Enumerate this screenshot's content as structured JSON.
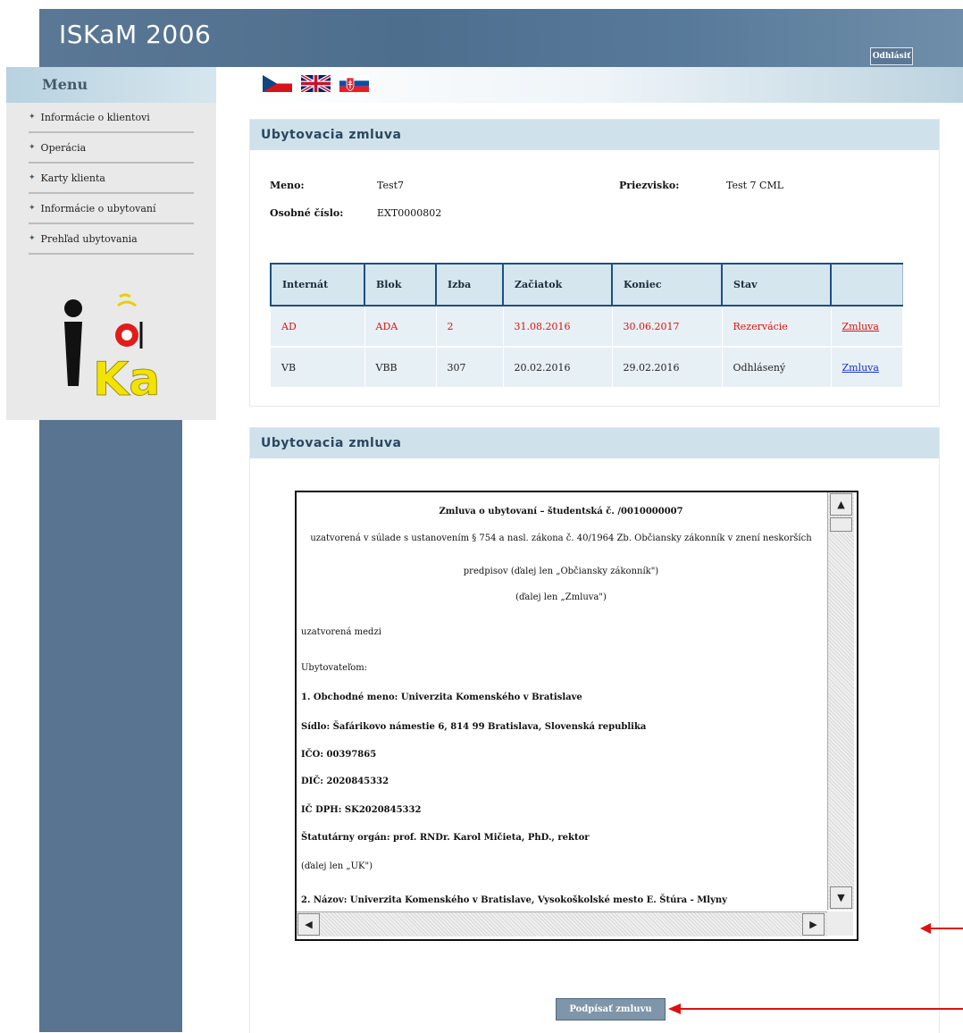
{
  "header": {
    "app_title": "ISKaM 2006",
    "logout_label": "Odhlásiť"
  },
  "languages": [
    "cs-flag-icon",
    "uk-flag-icon",
    "sk-flag-icon"
  ],
  "menu": {
    "title": "Menu",
    "items": [
      {
        "label": "Informácie o klientovi"
      },
      {
        "label": "Operácia"
      },
      {
        "label": "Karty klienta"
      },
      {
        "label": "Informácie o ubytovaní"
      },
      {
        "label": "Prehľad ubytovania"
      }
    ]
  },
  "contract_summary": {
    "title": "Ubytovacia zmluva",
    "name_label": "Meno:",
    "name_value": "Test7",
    "surname_label": "Priezvisko:",
    "surname_value": "Test 7 CML",
    "id_label": "Osobné číslo:",
    "id_value": "EXT0000802",
    "table": {
      "headers": [
        "Internát",
        "Blok",
        "Izba",
        "Začiatok",
        "Koniec",
        "Stav",
        ""
      ],
      "rows": [
        {
          "dorm": "AD",
          "block": "ADA",
          "room": "2",
          "start": "31.08.2016",
          "end": "30.06.2017",
          "status": "Rezervácie",
          "link": "Zmluva"
        },
        {
          "dorm": "VB",
          "block": "VBB",
          "room": "307",
          "start": "20.02.2016",
          "end": "29.02.2016",
          "status": "Odhlásený",
          "link": "Zmluva"
        }
      ]
    }
  },
  "contract_doc": {
    "title": "Ubytovacia zmluva",
    "lines": [
      "Zmluva o ubytovaní – študentská č. /0010000007",
      "uzatvorená v súlade s ustanovením § 754 a nasl. zákona č. 40/1964 Zb. Občiansky zákonník v znení neskorších",
      "predpisov (ďalej len „Občiansky zákonník\")",
      "(ďalej len „Zmluva\")",
      "uzatvorená medzi",
      "Ubytovateľom:",
      "1. Obchodné meno: Univerzita Komenského v Bratislave",
      "Sídlo: Šafárikovo námestie 6, 814 99 Bratislava, Slovenská republika",
      "IČO: 00397865",
      "DIČ: 2020845332",
      "IČ DPH: SK2020845332",
      "Štatutárny orgán: prof. RNDr. Karol Mičieta, PhD., rektor",
      "(ďalej len „UK\")",
      "2. Názov: Univerzita Komenského v Bratislave, Vysokoškolské mesto E. Štúra - Mlyny"
    ],
    "sign_button": "Podpísať zmluvu"
  }
}
